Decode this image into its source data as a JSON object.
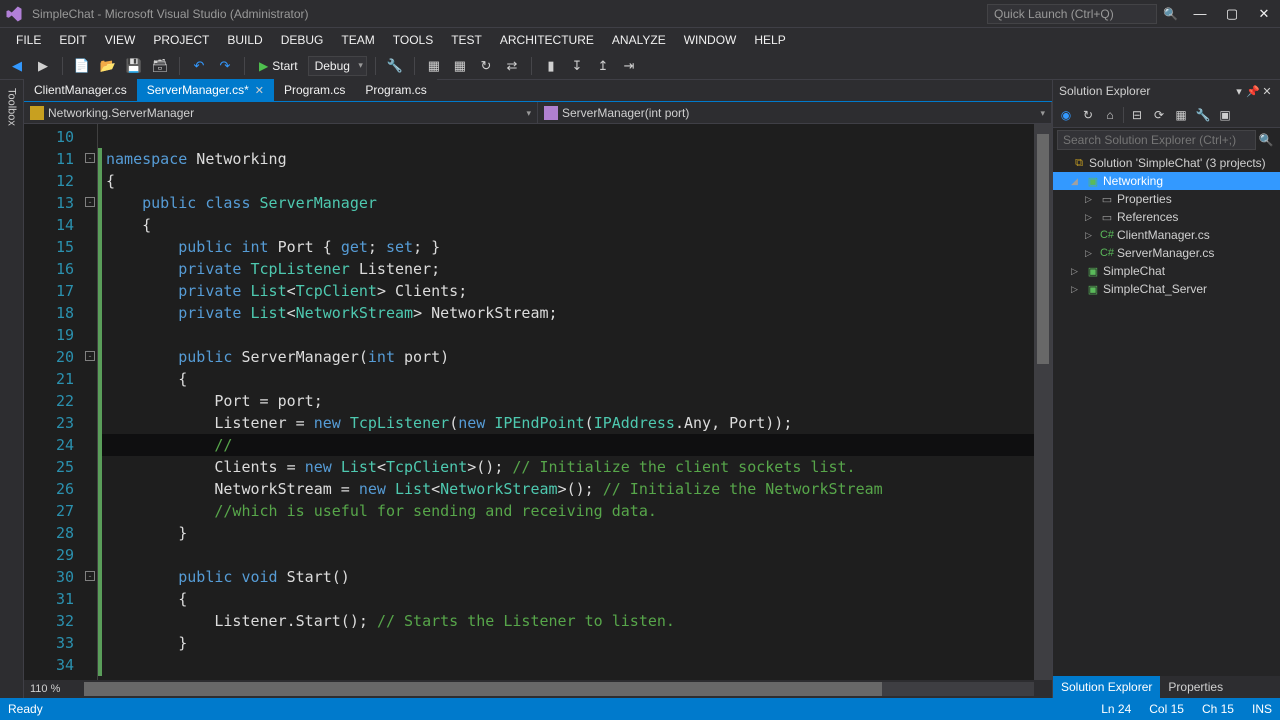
{
  "title": "SimpleChat - Microsoft Visual Studio (Administrator)",
  "quicklaunch_placeholder": "Quick Launch (Ctrl+Q)",
  "menu": [
    "FILE",
    "EDIT",
    "VIEW",
    "PROJECT",
    "BUILD",
    "DEBUG",
    "TEAM",
    "TOOLS",
    "TEST",
    "ARCHITECTURE",
    "ANALYZE",
    "WINDOW",
    "HELP"
  ],
  "toolbar": {
    "start": "Start",
    "config": "Debug"
  },
  "toolbox_label": "Toolbox",
  "tabs": [
    {
      "label": "ClientManager.cs",
      "active": false
    },
    {
      "label": "ServerManager.cs*",
      "active": true
    },
    {
      "label": "Program.cs",
      "active": false
    },
    {
      "label": "Program.cs",
      "active": false
    }
  ],
  "nav_left": "Networking.ServerManager",
  "nav_right": "ServerManager(int port)",
  "zoom": "110 %",
  "code": {
    "lines": [
      {
        "n": 10,
        "raw": ""
      },
      {
        "n": 11,
        "raw": "<span class='kw'>namespace</span> Networking"
      },
      {
        "n": 12,
        "raw": "{"
      },
      {
        "n": 13,
        "raw": "    <span class='kw'>public class</span> <span class='tp'>ServerManager</span>"
      },
      {
        "n": 14,
        "raw": "    {"
      },
      {
        "n": 15,
        "raw": "        <span class='kw'>public int</span> Port { <span class='kw'>get</span>; <span class='kw'>set</span>; }"
      },
      {
        "n": 16,
        "raw": "        <span class='kw'>private</span> <span class='tp'>TcpListener</span> Listener;"
      },
      {
        "n": 17,
        "raw": "        <span class='kw'>private</span> <span class='tp'>List</span>&lt;<span class='tp'>TcpClient</span>&gt; Clients;"
      },
      {
        "n": 18,
        "raw": "        <span class='kw'>private</span> <span class='tp'>List</span>&lt;<span class='tp'>NetworkStream</span>&gt; NetworkStream;"
      },
      {
        "n": 19,
        "raw": ""
      },
      {
        "n": 20,
        "raw": "        <span class='kw'>public</span> ServerManager(<span class='kw'>int</span> port)"
      },
      {
        "n": 21,
        "raw": "        {"
      },
      {
        "n": 22,
        "raw": "            Port = port;"
      },
      {
        "n": 23,
        "raw": "            Listener = <span class='kw'>new</span> <span class='tp'>TcpListener</span>(<span class='kw'>new</span> <span class='tp'>IPEndPoint</span>(<span class='tp'>IPAddress</span>.Any, Port));"
      },
      {
        "n": 24,
        "raw": "            <span class='cm'>//</span>",
        "hl": true
      },
      {
        "n": 25,
        "raw": "            Clients = <span class='kw'>new</span> <span class='tp'>List</span>&lt;<span class='tp'>TcpClient</span>&gt;(); <span class='cm'>// Initialize the client sockets list.</span>"
      },
      {
        "n": 26,
        "raw": "            NetworkStream = <span class='kw'>new</span> <span class='tp'>List</span>&lt;<span class='tp'>NetworkStream</span>&gt;(); <span class='cm'>// Initialize the NetworkStream</span>"
      },
      {
        "n": 27,
        "raw": "            <span class='cm'>//which is useful for sending and receiving data.</span>"
      },
      {
        "n": 28,
        "raw": "        }"
      },
      {
        "n": 29,
        "raw": ""
      },
      {
        "n": 30,
        "raw": "        <span class='kw'>public void</span> Start()"
      },
      {
        "n": 31,
        "raw": "        {"
      },
      {
        "n": 32,
        "raw": "            Listener.Start(); <span class='cm'>// Starts the Listener to listen.</span>"
      },
      {
        "n": 33,
        "raw": "        }"
      },
      {
        "n": 34,
        "raw": ""
      }
    ],
    "fold_marks": [
      11,
      13,
      20,
      30
    ],
    "changed": [
      11,
      12,
      13,
      14,
      15,
      16,
      17,
      18,
      19,
      20,
      21,
      22,
      23,
      24,
      25,
      26,
      27,
      28,
      29,
      30,
      31,
      32,
      33,
      34
    ]
  },
  "solution": {
    "header": "Solution Explorer",
    "search_placeholder": "Search Solution Explorer (Ctrl+;)",
    "root": "Solution 'SimpleChat' (3 projects)",
    "project": "Networking",
    "properties": "Properties",
    "references": "References",
    "files": [
      "ClientManager.cs",
      "ServerManager.cs"
    ],
    "other_projects": [
      "SimpleChat",
      "SimpleChat_Server"
    ],
    "bottom_tabs": [
      "Solution Explorer",
      "Properties"
    ]
  },
  "status": {
    "ready": "Ready",
    "ln": "Ln 24",
    "col": "Col 15",
    "ch": "Ch 15",
    "ins": "INS"
  }
}
